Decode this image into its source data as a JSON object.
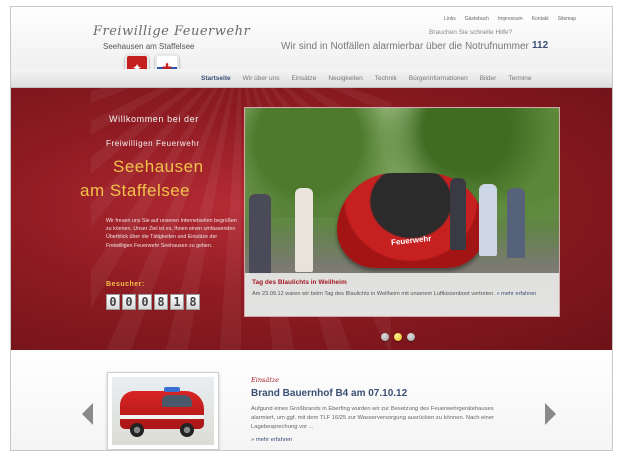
{
  "header": {
    "logo_script": "Freiwillige Feuerwehr",
    "logo_sub": "Seehausen am Staffelsee",
    "top_links": [
      "Links",
      "Gästebuch",
      "Impressum",
      "Kontakt",
      "Sitemap"
    ],
    "help_question": "Brauchen Sie schnelle Hilfe?",
    "emergency_text": "Wir sind in Notfällen alarmierbar über die Notrufnummer",
    "emergency_number": "112"
  },
  "nav": {
    "items": [
      "Startseite",
      "Wir über uns",
      "Einsätze",
      "Neuigkeiten",
      "Technik",
      "Bürgerinformationen",
      "Bilder",
      "Termine"
    ],
    "active_index": 0
  },
  "hero": {
    "welcome_line1": "Willkommen bei der",
    "welcome_line2": "Freiwilligen Feuerwehr",
    "town_line1": "Seehausen",
    "town_line2": "am Staffelsee",
    "intro": "Wir freuen uns Sie auf unseren Internetseiten begrüßen zu können. Unser Ziel ist es, Ihnen einen umfassenden Überblick über die Tätigkeiten und Einsätze der Freiwilligen Feuerwehr Seehausen zu geben.",
    "visitors_label": "Besucher:",
    "visitor_digits": [
      "0",
      "0",
      "0",
      "8",
      "1",
      "8"
    ]
  },
  "slideshow": {
    "boat_label": "Feuerwehr",
    "caption_title": "Tag des Blaulichts in Weilheim",
    "caption_text": "Am 23.09.12 waren wir beim Tag des Blaulichts in Weilheim mit unserem Luftkissenboot vertreten.",
    "caption_more": "» mehr erfahren",
    "slide_count": 3,
    "active_slide": 1
  },
  "teaser": {
    "category": "Einsätze",
    "title": "Brand Bauernhof B4 am 07.10.12",
    "text": "Aufgund eines Großbrands in Eberfing wurden wir zur Besetzung des Feuerwehrgerätehauses alarmiert, um ggf. mit dem TLF 16/25 zur Wasserversorgung ausrücken zu können. Nach einer Lagebesprechung vor ...",
    "more": "» mehr erfahren"
  },
  "colors": {
    "brand_red": "#8f1b22",
    "accent_gold": "#f1c24a",
    "link_blue": "#3a4f74"
  }
}
